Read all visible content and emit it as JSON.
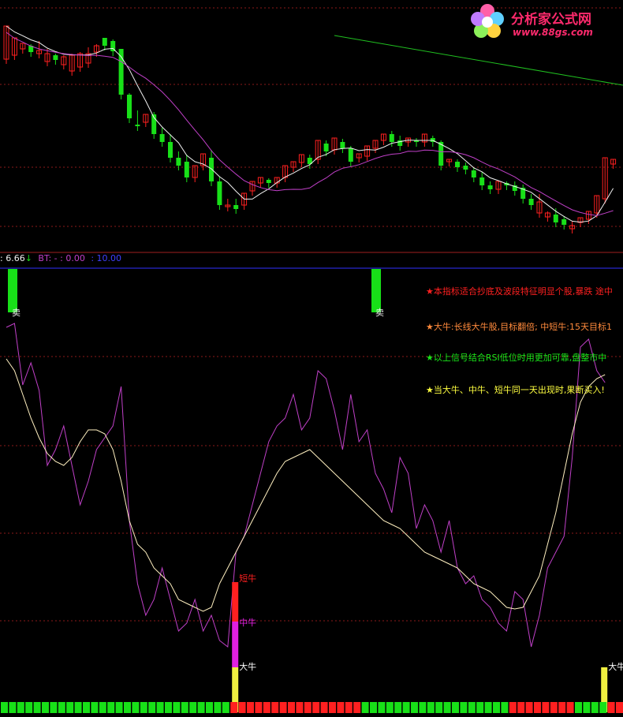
{
  "watermark": {
    "title": "分析家公式网",
    "url": "www.88gs.com"
  },
  "readout": {
    "value_1": ": 6.66",
    "arrow": "↓",
    "bt_label": "BT: - : 0.00",
    "bt_value": ": 10.00"
  },
  "notes": [
    {
      "text": "★本指标适合抄底及波段特征明显个股,暴跌 途中",
      "color": "#ff2020"
    },
    {
      "text": "★大牛:长线大牛股,目标翻倍; 中短牛:15天目标1",
      "color": "#ff8a3c"
    },
    {
      "text": "★以上信号结合RSI低位时用更加可靠,盘整市中",
      "color": "#19e619"
    },
    {
      "text": "★当大牛、中牛、短牛同一天出现时,果断买入!",
      "color": "#ffff40"
    }
  ],
  "colors": {
    "bull": "#ff2020",
    "bear": "#18e018",
    "ma_short": "#f0f0f0",
    "ma_long": "#c040c8",
    "ma_far": "#20c020",
    "osc_fast": "#c040c8",
    "osc_slow": "#fff0c0",
    "grid": "#8b1a1a",
    "separator": "#3030ff"
  },
  "chart_data": [
    {
      "type": "candlestick",
      "panel": "price",
      "candles": [
        [
          0,
          55,
          13,
          35,
          0,
          "up"
        ],
        [
          1,
          50,
          28,
          34,
          3,
          "up"
        ],
        [
          2,
          42,
          35,
          38,
          30,
          "up"
        ],
        [
          3,
          38,
          46,
          36,
          32,
          "down"
        ],
        [
          4,
          44,
          48,
          32,
          28,
          "up"
        ],
        [
          5,
          58,
          48,
          42,
          26,
          "up"
        ],
        [
          6,
          56,
          50,
          48,
          30,
          "down"
        ],
        [
          7,
          62,
          52,
          50,
          38,
          "up"
        ],
        [
          8,
          70,
          50,
          48,
          38,
          "up"
        ],
        [
          9,
          65,
          48,
          46,
          40,
          "up"
        ],
        [
          10,
          60,
          48,
          40,
          34,
          "up"
        ],
        [
          11,
          46,
          38,
          36,
          30,
          "up"
        ],
        [
          12,
          38,
          28,
          32,
          18,
          "down"
        ],
        [
          13,
          32,
          45,
          30,
          28,
          "down"
        ],
        [
          14,
          42,
          100,
          42,
          26,
          "down"
        ],
        [
          15,
          100,
          130,
          98,
          86,
          "down"
        ],
        [
          16,
          138,
          140,
          120,
          96,
          "down"
        ],
        [
          17,
          135,
          125,
          135,
          132,
          "up"
        ],
        [
          18,
          125,
          150,
          122,
          120,
          "down"
        ],
        [
          19,
          150,
          160,
          142,
          138,
          "down"
        ],
        [
          20,
          160,
          180,
          150,
          146,
          "down"
        ],
        [
          21,
          180,
          190,
          172,
          175,
          "down"
        ],
        [
          22,
          185,
          205,
          176,
          180,
          "down"
        ],
        [
          23,
          205,
          190,
          200,
          192,
          "up"
        ],
        [
          24,
          190,
          175,
          186,
          170,
          "up"
        ],
        [
          25,
          180,
          210,
          170,
          178,
          "down"
        ],
        [
          26,
          210,
          240,
          204,
          200,
          "down"
        ],
        [
          27,
          240,
          242,
          232,
          220,
          "up"
        ],
        [
          28,
          240,
          245,
          232,
          222,
          "down"
        ],
        [
          29,
          240,
          225,
          236,
          220,
          "up"
        ],
        [
          30,
          222,
          210,
          218,
          200,
          "up"
        ],
        [
          31,
          212,
          205,
          210,
          198,
          "up"
        ],
        [
          32,
          208,
          212,
          206,
          200,
          "down"
        ],
        [
          33,
          212,
          205,
          210,
          200,
          "up"
        ],
        [
          34,
          205,
          190,
          200,
          188,
          "up"
        ],
        [
          35,
          192,
          185,
          190,
          180,
          "up"
        ],
        [
          36,
          186,
          176,
          184,
          168,
          "up"
        ],
        [
          37,
          180,
          188,
          176,
          172,
          "down"
        ],
        [
          38,
          182,
          158,
          180,
          150,
          "up"
        ],
        [
          39,
          162,
          172,
          158,
          155,
          "down"
        ],
        [
          40,
          170,
          155,
          168,
          150,
          "up"
        ],
        [
          41,
          160,
          168,
          156,
          150,
          "down"
        ],
        [
          42,
          168,
          185,
          165,
          165,
          "down"
        ],
        [
          43,
          180,
          175,
          178,
          172,
          "up"
        ],
        [
          44,
          178,
          165,
          176,
          160,
          "up"
        ],
        [
          45,
          168,
          158,
          165,
          150,
          "up"
        ],
        [
          46,
          158,
          150,
          155,
          140,
          "up"
        ],
        [
          47,
          150,
          160,
          146,
          142,
          "down"
        ],
        [
          48,
          158,
          165,
          152,
          148,
          "down"
        ],
        [
          49,
          160,
          155,
          158,
          150,
          "up"
        ],
        [
          50,
          158,
          160,
          155,
          148,
          "down"
        ],
        [
          51,
          160,
          150,
          158,
          148,
          "up"
        ],
        [
          52,
          155,
          160,
          152,
          150,
          "down"
        ],
        [
          53,
          160,
          190,
          158,
          156,
          "down"
        ],
        [
          54,
          185,
          182,
          188,
          178,
          "up"
        ],
        [
          55,
          185,
          192,
          182,
          180,
          "down"
        ],
        [
          56,
          190,
          195,
          186,
          186,
          "down"
        ],
        [
          57,
          196,
          205,
          192,
          190,
          "down"
        ],
        [
          58,
          205,
          215,
          198,
          198,
          "down"
        ],
        [
          59,
          215,
          220,
          210,
          210,
          "down"
        ],
        [
          60,
          220,
          210,
          218,
          205,
          "up"
        ],
        [
          61,
          212,
          215,
          210,
          208,
          "down"
        ],
        [
          62,
          215,
          222,
          210,
          212,
          "down"
        ],
        [
          63,
          218,
          232,
          214,
          215,
          "down"
        ],
        [
          64,
          232,
          240,
          226,
          226,
          "down"
        ],
        [
          65,
          236,
          250,
          226,
          238,
          "up"
        ],
        [
          66,
          250,
          255,
          248,
          245,
          "up"
        ],
        [
          67,
          252,
          262,
          244,
          248,
          "down"
        ],
        [
          68,
          258,
          265,
          254,
          254,
          "down"
        ],
        [
          69,
          266,
          270,
          260,
          258,
          "up"
        ],
        [
          70,
          262,
          256,
          264,
          250,
          "up"
        ],
        [
          71,
          258,
          248,
          256,
          240,
          "up"
        ],
        [
          72,
          250,
          228,
          250,
          222,
          "up"
        ],
        [
          73,
          232,
          180,
          236,
          175,
          "up"
        ],
        [
          74,
          188,
          182,
          190,
          178,
          "up"
        ]
      ]
    },
    {
      "type": "line",
      "panel": "oscillator",
      "series": [
        {
          "key": "fast",
          "values": [
            415,
            410,
            488,
            460,
            495,
            590,
            570,
            540,
            590,
            640,
            610,
            570,
            555,
            540,
            490,
            660,
            740,
            780,
            760,
            720,
            760,
            800,
            790,
            760,
            800,
            780,
            812,
            820,
            700,
            680,
            640,
            600,
            560,
            540,
            530,
            500,
            545,
            530,
            470,
            480,
            520,
            570,
            500,
            560,
            545,
            600,
            620,
            650,
            580,
            600,
            670,
            640,
            660,
            700,
            660,
            720,
            740,
            730,
            760,
            770,
            790,
            800,
            750,
            760,
            820,
            780,
            720,
            700,
            680,
            580,
            440,
            430,
            470,
            485
          ]
        },
        {
          "key": "slow",
          "values": [
            455,
            470,
            500,
            530,
            555,
            575,
            585,
            590,
            580,
            560,
            545,
            545,
            550,
            570,
            610,
            660,
            690,
            700,
            720,
            730,
            740,
            760,
            765,
            770,
            775,
            770,
            740,
            720,
            700,
            680,
            660,
            640,
            620,
            600,
            585,
            580,
            575,
            570,
            580,
            590,
            600,
            610,
            620,
            630,
            640,
            650,
            660,
            665,
            670,
            680,
            690,
            700,
            705,
            710,
            715,
            720,
            730,
            740,
            745,
            750,
            760,
            770,
            772,
            770,
            750,
            730,
            690,
            650,
            600,
            550,
            510,
            490,
            480,
            475
          ]
        }
      ]
    }
  ],
  "signals": [
    {
      "label": "卖",
      "color": "#18e018",
      "col": 0
    },
    {
      "label": "卖",
      "color": "#18e018",
      "col": 45
    },
    {
      "label": "短牛",
      "color": "#ff2020",
      "col": 28
    },
    {
      "label": "中牛",
      "color": "#e020e0",
      "col": 28
    },
    {
      "label": "大牛",
      "color": "#f0f040",
      "col": 28
    },
    {
      "label": "大牛",
      "color": "#f0f040",
      "col": 73
    }
  ],
  "bottom_strip": {
    "green_until_col": 28,
    "red_from_col": 28,
    "green_from_col": 44,
    "red_again_from_col": 62,
    "green_again_from_col": 70
  }
}
